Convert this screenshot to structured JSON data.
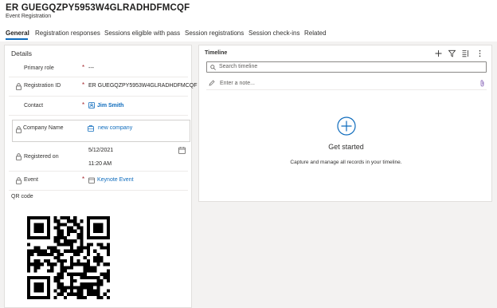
{
  "header": {
    "title": "ER GUEGQZPY5953W4GLRADHDFMCQF",
    "subtitle": "Event Registration"
  },
  "tabs": [
    {
      "label": "General"
    },
    {
      "label": "Registration responses"
    },
    {
      "label": "Sessions eligible with pass"
    },
    {
      "label": "Session registrations"
    },
    {
      "label": "Session check-ins"
    },
    {
      "label": "Related"
    }
  ],
  "details": {
    "section_title": "Details",
    "primary_role": {
      "label": "Primary role",
      "value": "---"
    },
    "registration_id": {
      "label": "Registration ID",
      "value": "ER GUEGQZPY5953W4GLRADHDFMCQF"
    },
    "contact": {
      "label": "Contact",
      "value": "Jim Smith"
    },
    "company_name": {
      "label": "Company Name",
      "value": "new company"
    },
    "registered_on": {
      "label": "Registered on",
      "date": "5/12/2021",
      "time": "11:20 AM"
    },
    "event": {
      "label": "Event",
      "value": "Keynote Event"
    },
    "qr_label": "QR code"
  },
  "timeline": {
    "label": "Timeline",
    "search_placeholder": "Search timeline",
    "note_placeholder": "Enter a note...",
    "get_started": "Get started",
    "description": "Capture and manage all records in your timeline."
  },
  "colors": {
    "accent": "#0f6cbd",
    "required": "#a4262c",
    "background": "#f3f2f1"
  },
  "icons": [
    "lock-icon",
    "contact-icon",
    "account-icon",
    "calendar-icon",
    "event-icon",
    "add-icon",
    "filter-icon",
    "list-icon",
    "more-icon",
    "search-icon",
    "pencil-icon",
    "attach-icon",
    "add-circle-icon"
  ]
}
